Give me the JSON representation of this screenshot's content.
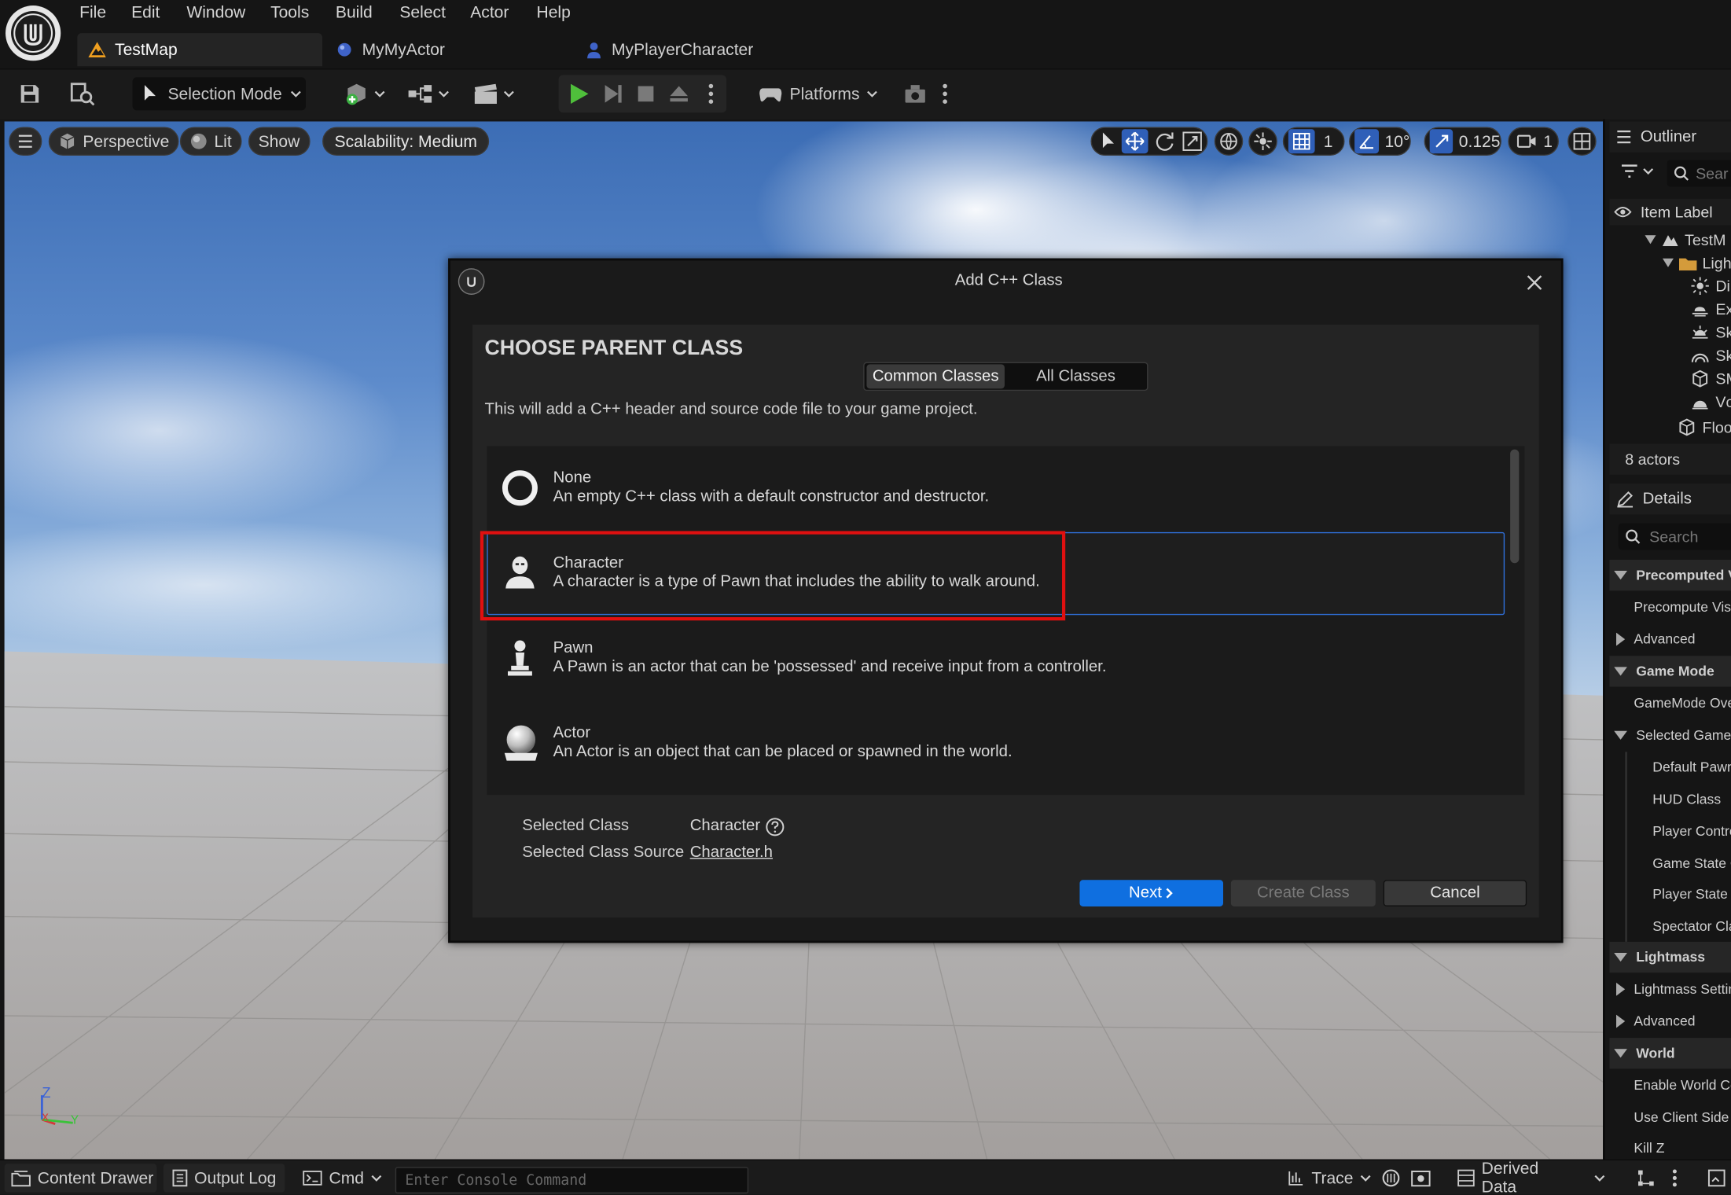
{
  "menu": [
    "File",
    "Edit",
    "Window",
    "Tools",
    "Build",
    "Select",
    "Actor",
    "Help"
  ],
  "tabs": [
    {
      "label": "TestMap",
      "active": true
    },
    {
      "label": "MyMyActor",
      "active": false
    },
    {
      "label": "MyPlayerCharacter",
      "active": false
    }
  ],
  "toolbar": {
    "selection_mode": "Selection Mode",
    "platforms": "Platforms"
  },
  "viewport": {
    "perspective": "Perspective",
    "lit": "Lit",
    "show": "Show",
    "scalability": "Scalability: Medium",
    "grid_size": "1",
    "angle_snap": "10°",
    "scale_snap": "0.125",
    "camera_speed": "1",
    "axis_z": "Z",
    "axis_x": "x",
    "axis_y": "Y"
  },
  "dialog": {
    "title": "Add C++ Class",
    "heading": "CHOOSE PARENT CLASS",
    "tab_common": "Common Classes",
    "tab_all": "All Classes",
    "description": "This will add a C++ header and source code file to your game project.",
    "classes": [
      {
        "name": "None",
        "desc": "An empty C++ class with a default constructor and destructor."
      },
      {
        "name": "Character",
        "desc": "A character is a type of Pawn that includes the ability to walk around."
      },
      {
        "name": "Pawn",
        "desc": "A Pawn is an actor that can be 'possessed' and receive input from a controller."
      },
      {
        "name": "Actor",
        "desc": "An Actor is an object that can be placed or spawned in the world."
      }
    ],
    "selected_class_label": "Selected Class",
    "selected_class_value": "Character",
    "selected_source_label": "Selected Class Source",
    "selected_source_value": "Character.h",
    "next": "Next",
    "create": "Create Class",
    "cancel": "Cancel"
  },
  "outliner": {
    "title": "Outliner",
    "search_placeholder": "Sear",
    "column": "Item Label",
    "items": [
      "TestM",
      "Ligh",
      "Di",
      "Ex",
      "Sk",
      "Sk",
      "SM",
      "Vc",
      "Floo"
    ],
    "count": "8 actors"
  },
  "details": {
    "title": "Details",
    "search_placeholder": "Search",
    "rows": [
      {
        "label": "Precomputed Vis",
        "kind": "cat-open"
      },
      {
        "label": "Precompute Visib",
        "kind": "prop"
      },
      {
        "label": "Advanced",
        "kind": "cat-closed"
      },
      {
        "label": "Game Mode",
        "kind": "cat-open"
      },
      {
        "label": "GameMode Overr",
        "kind": "prop"
      },
      {
        "label": "Selected GameMo",
        "kind": "sub-open"
      },
      {
        "label": "Default Pawn",
        "kind": "prop2"
      },
      {
        "label": "HUD Class",
        "kind": "prop2"
      },
      {
        "label": "Player Contro",
        "kind": "prop2"
      },
      {
        "label": "Game State C",
        "kind": "prop2"
      },
      {
        "label": "Player State C",
        "kind": "prop2"
      },
      {
        "label": "Spectator Clas",
        "kind": "prop2"
      },
      {
        "label": "Lightmass",
        "kind": "cat-open"
      },
      {
        "label": "Lightmass Settin",
        "kind": "cat-closed"
      },
      {
        "label": "Advanced",
        "kind": "cat-closed"
      },
      {
        "label": "World",
        "kind": "cat-open"
      },
      {
        "label": "Enable World Co",
        "kind": "prop"
      },
      {
        "label": "Use Client Side L",
        "kind": "prop"
      },
      {
        "label": "Kill Z",
        "kind": "prop"
      }
    ]
  },
  "statusbar": {
    "content_drawer": "Content Drawer",
    "output_log": "Output Log",
    "cmd": "Cmd",
    "console_placeholder": "Enter Console Command",
    "trace": "Trace",
    "derived_data": "Derived Data"
  }
}
